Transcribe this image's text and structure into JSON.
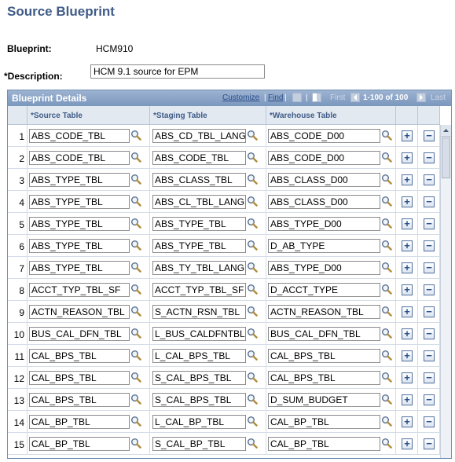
{
  "page": {
    "title": "Source Blueprint"
  },
  "form": {
    "blueprint_label": "Blueprint:",
    "blueprint_value": "HCM910",
    "description_label": "*Description:",
    "description_value": "HCM 9.1 source for EPM"
  },
  "grid": {
    "title": "Blueprint Details",
    "customize": "Customize",
    "sep": "|",
    "find": "Find",
    "first": "First",
    "range": "1-100 of 100",
    "last": "Last",
    "columns": {
      "source": "*Source Table",
      "staging": "*Staging Table",
      "warehouse": "*Warehouse Table"
    },
    "rows": [
      {
        "num": "1",
        "source": "ABS_CODE_TBL",
        "staging": "ABS_CD_TBL_LANG",
        "warehouse": "ABS_CODE_D00"
      },
      {
        "num": "2",
        "source": "ABS_CODE_TBL",
        "staging": "ABS_CODE_TBL",
        "warehouse": "ABS_CODE_D00"
      },
      {
        "num": "3",
        "source": "ABS_TYPE_TBL",
        "staging": "ABS_CLASS_TBL",
        "warehouse": "ABS_CLASS_D00"
      },
      {
        "num": "4",
        "source": "ABS_TYPE_TBL",
        "staging": "ABS_CL_TBL_LANG",
        "warehouse": "ABS_CLASS_D00"
      },
      {
        "num": "5",
        "source": "ABS_TYPE_TBL",
        "staging": "ABS_TYPE_TBL",
        "warehouse": "ABS_TYPE_D00"
      },
      {
        "num": "6",
        "source": "ABS_TYPE_TBL",
        "staging": "ABS_TYPE_TBL",
        "warehouse": "D_AB_TYPE"
      },
      {
        "num": "7",
        "source": "ABS_TYPE_TBL",
        "staging": "ABS_TY_TBL_LANG",
        "warehouse": "ABS_TYPE_D00"
      },
      {
        "num": "8",
        "source": "ACCT_TYP_TBL_SF",
        "staging": "ACCT_TYP_TBL_SF",
        "warehouse": "D_ACCT_TYPE"
      },
      {
        "num": "9",
        "source": "ACTN_REASON_TBL",
        "staging": "S_ACTN_RSN_TBL",
        "warehouse": "ACTN_REASON_TBL"
      },
      {
        "num": "10",
        "source": "BUS_CAL_DFN_TBL",
        "staging": "L_BUS_CALDFNTBL",
        "warehouse": "BUS_CAL_DFN_TBL"
      },
      {
        "num": "11",
        "source": "CAL_BPS_TBL",
        "staging": "L_CAL_BPS_TBL",
        "warehouse": "CAL_BPS_TBL"
      },
      {
        "num": "12",
        "source": "CAL_BPS_TBL",
        "staging": "S_CAL_BPS_TBL",
        "warehouse": "CAL_BPS_TBL"
      },
      {
        "num": "13",
        "source": "CAL_BPS_TBL",
        "staging": "S_CAL_BPS_TBL",
        "warehouse": "D_SUM_BUDGET"
      },
      {
        "num": "14",
        "source": "CAL_BP_TBL",
        "staging": "L_CAL_BP_TBL",
        "warehouse": "CAL_BP_TBL"
      },
      {
        "num": "15",
        "source": "CAL_BP_TBL",
        "staging": "S_CAL_BP_TBL",
        "warehouse": "CAL_BP_TBL"
      }
    ]
  },
  "icons": {
    "lookup": "magnifier-icon",
    "add": "plus-icon",
    "delete": "minus-icon"
  },
  "colors": {
    "title": "#3f5b87",
    "grid_header": "#8aa4c6",
    "column_header_text": "#3f5b87"
  }
}
